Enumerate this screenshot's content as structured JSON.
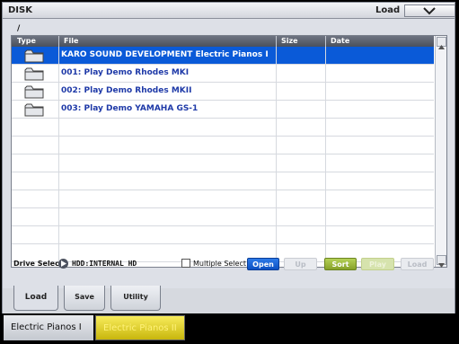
{
  "window": {
    "title": "DISK",
    "mode_label": "Load"
  },
  "path": "/",
  "table": {
    "headers": {
      "type": "Type",
      "file": "File",
      "size": "Size",
      "date": "Date"
    },
    "rows": [
      {
        "name": "KARO SOUND DEVELOPMENT Electric Pianos I",
        "icon": "folder-icon",
        "selected": true
      },
      {
        "name": "001: Play Demo Rhodes MKI",
        "icon": "folder-icon",
        "selected": false
      },
      {
        "name": "002: Play Demo Rhodes MKII",
        "icon": "folder-icon",
        "selected": false
      },
      {
        "name": "003: Play Demo YAMAHA GS-1",
        "icon": "folder-icon",
        "selected": false
      }
    ]
  },
  "drive": {
    "label": "Drive Select:",
    "value": "HDD:INTERNAL HD"
  },
  "multiple_select": {
    "label": "Multiple Select",
    "checked": false
  },
  "buttons": {
    "open": "Open",
    "up": "Up",
    "sort": "Sort",
    "play": "Play",
    "load": "Load"
  },
  "tabs": [
    {
      "label": "Load"
    },
    {
      "label": "Save"
    },
    {
      "label": "Utility"
    }
  ],
  "bottom_tabs": [
    {
      "label": "Electric Pianos I"
    },
    {
      "label": "Electric Pianos II"
    }
  ],
  "colors": {
    "selection": "#0a5ad8",
    "file_text": "#1f3aa8",
    "open_button": "#0c50c2",
    "sort_button": "#86a12a",
    "tab2_yellow": "#f0e040"
  }
}
